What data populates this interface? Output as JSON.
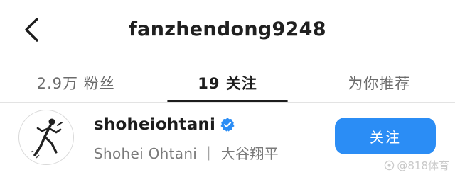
{
  "header": {
    "title": "fanzhendong9248",
    "back_icon": "chevron-left-icon"
  },
  "tabs": [
    {
      "label": "2.9万 粉丝",
      "active": false
    },
    {
      "label": "19 关注",
      "active": true
    },
    {
      "label": "为你推荐",
      "active": false
    }
  ],
  "user": {
    "handle": "shoheiohtani",
    "full_name": "Shohei Ohtani ｜ 大谷翔平",
    "verified": true,
    "verified_icon": "verified-badge-icon",
    "follow_label": "关注"
  },
  "colors": {
    "accent": "#2b8df5",
    "text_primary": "#1f1f1f",
    "text_secondary": "#7a7a7a"
  },
  "watermark": {
    "text": "@818体育"
  }
}
